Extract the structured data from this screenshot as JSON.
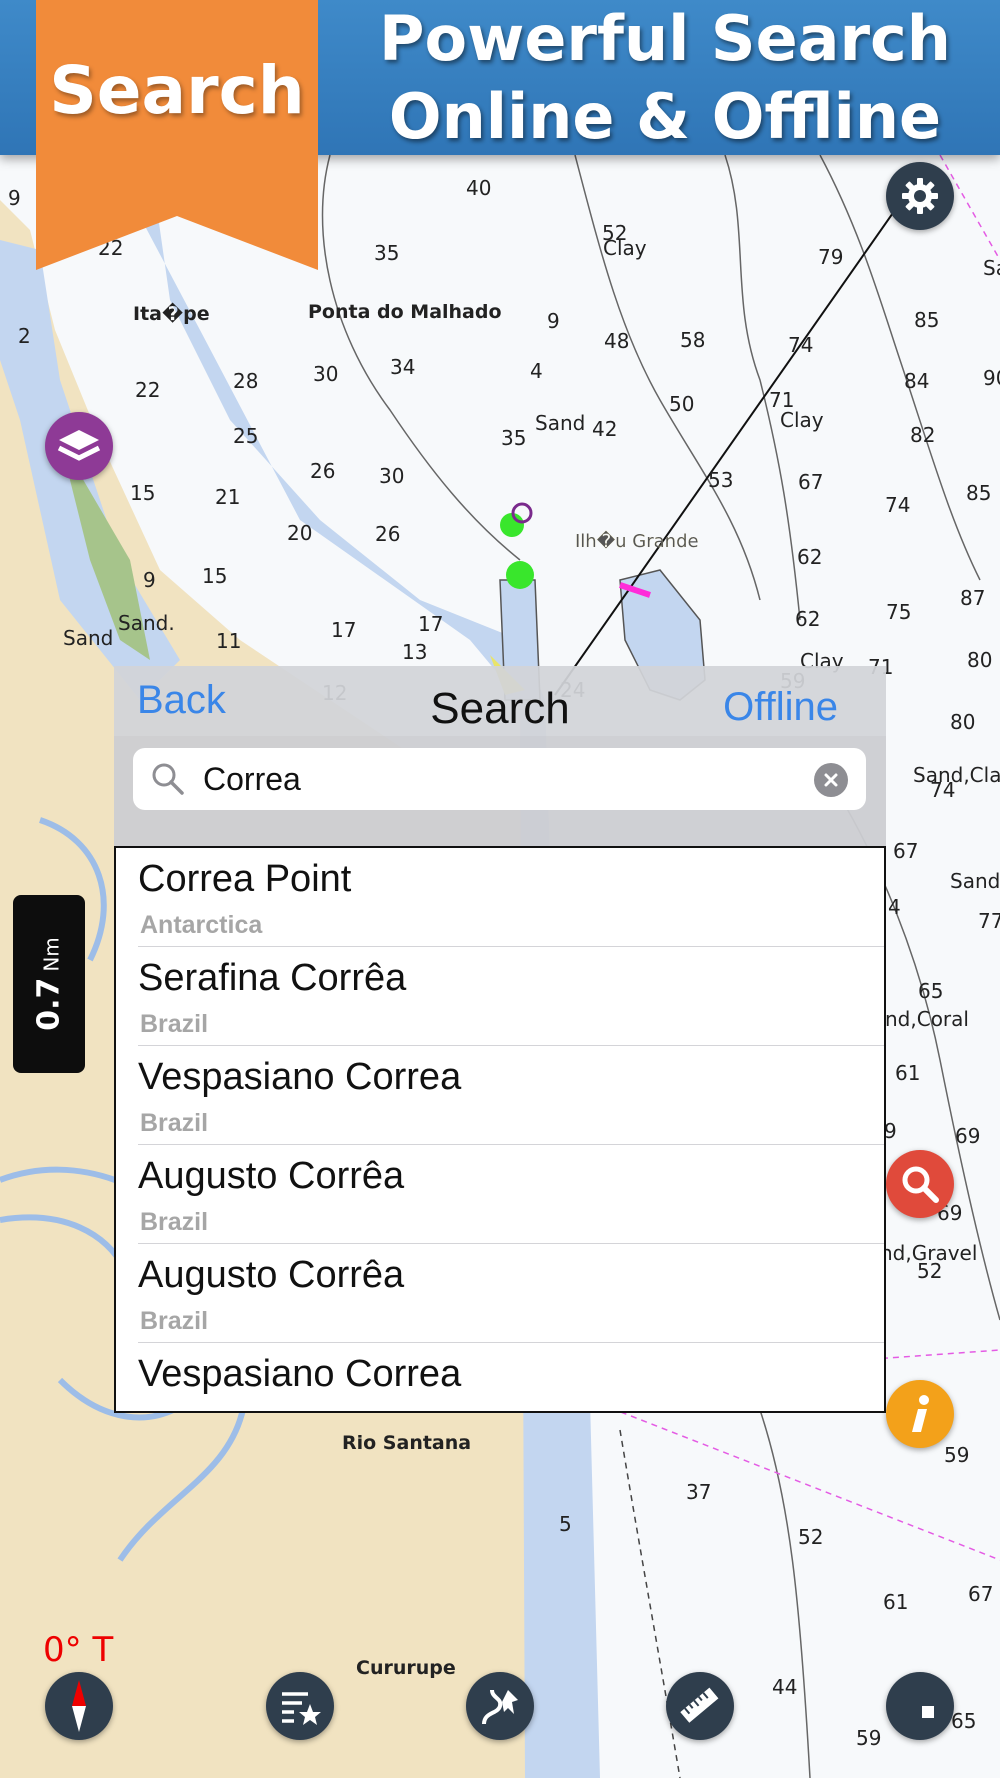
{
  "promo": {
    "ribbon_label": "Search",
    "title_line1": "Powerful Search",
    "title_line2": "Online & Offline"
  },
  "map": {
    "places": [
      "Ita�pe",
      "Ponta do Malhado",
      "Ilh�u Grande",
      "Rio Santana",
      "Cururupe"
    ],
    "seabed_labels": [
      "Clay",
      "Sand",
      "Sand",
      "Sand.",
      "Clay",
      "Clay",
      "Sand,Cla",
      "Sand",
      "nd,Coral",
      "nd,Gravel",
      "Sa"
    ],
    "depths": [
      "9",
      "22",
      "40",
      "35",
      "52",
      "79",
      "2",
      "9",
      "48",
      "58",
      "74",
      "85",
      "22",
      "28",
      "30",
      "34",
      "4",
      "71",
      "84",
      "90",
      "25",
      "35",
      "42",
      "50",
      "82",
      "15",
      "21",
      "26",
      "30",
      "53",
      "67",
      "85",
      "20",
      "26",
      "62",
      "74",
      "9",
      "15",
      "87",
      "17",
      "17",
      "62",
      "75",
      "11",
      "13",
      "80",
      "12",
      "24",
      "59",
      "71",
      "80",
      "74",
      "67",
      "4",
      "77",
      "65",
      "61",
      "9",
      "69",
      "69",
      "52",
      "37",
      "5",
      "52",
      "61",
      "67",
      "44",
      "65",
      "59",
      "59"
    ]
  },
  "scale": {
    "value": "0.7",
    "unit": "Nm"
  },
  "heading": "0° T",
  "search": {
    "back_label": "Back",
    "title": "Search",
    "offline_label": "Offline",
    "query": "Correa",
    "results": [
      {
        "name": "Correa Point",
        "country": "Antarctica"
      },
      {
        "name": "Serafina Corrêa",
        "country": "Brazil"
      },
      {
        "name": "Vespasiano Correa",
        "country": "Brazil"
      },
      {
        "name": "Augusto Corrêa",
        "country": "Brazil"
      },
      {
        "name": "Augusto Corrêa",
        "country": "Brazil"
      },
      {
        "name": "Vespasiano Correa",
        "country": ""
      }
    ]
  },
  "icons": {
    "settings": "gear-icon",
    "layers": "layers-icon",
    "search": "magnifier-icon",
    "info": "info-icon",
    "compass": "compass-icon",
    "favorites": "favorites-list-icon",
    "route": "route-icon",
    "ruler": "ruler-icon",
    "stop": "stop-icon"
  },
  "colors": {
    "land": "#f1e3c1",
    "shallow_water": "#c3d6f0",
    "deep_water": "#ffffff",
    "banner_blue": "#2f75b6",
    "ribbon_orange": "#f18b3a",
    "link_blue": "#3a86e8"
  }
}
